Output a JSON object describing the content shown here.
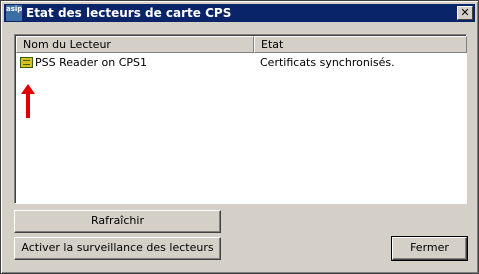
{
  "window": {
    "title": "Etat des lecteurs de carte CPS",
    "icon_text": "asip",
    "close_glyph": "✕"
  },
  "list": {
    "columns": [
      "Nom du Lecteur",
      "Etat"
    ],
    "rows": [
      {
        "name": "PSS Reader on CPS1",
        "state": "Certificats synchronisés.",
        "icon": "card-reader-icon"
      }
    ]
  },
  "buttons": {
    "refresh": "Rafraîchir",
    "monitor": "Activer la surveillance des lecteurs",
    "close": "Fermer"
  },
  "colors": {
    "titlebar": "#0a246a",
    "face": "#d4d0c8",
    "annotation_arrow": "#e00000"
  }
}
